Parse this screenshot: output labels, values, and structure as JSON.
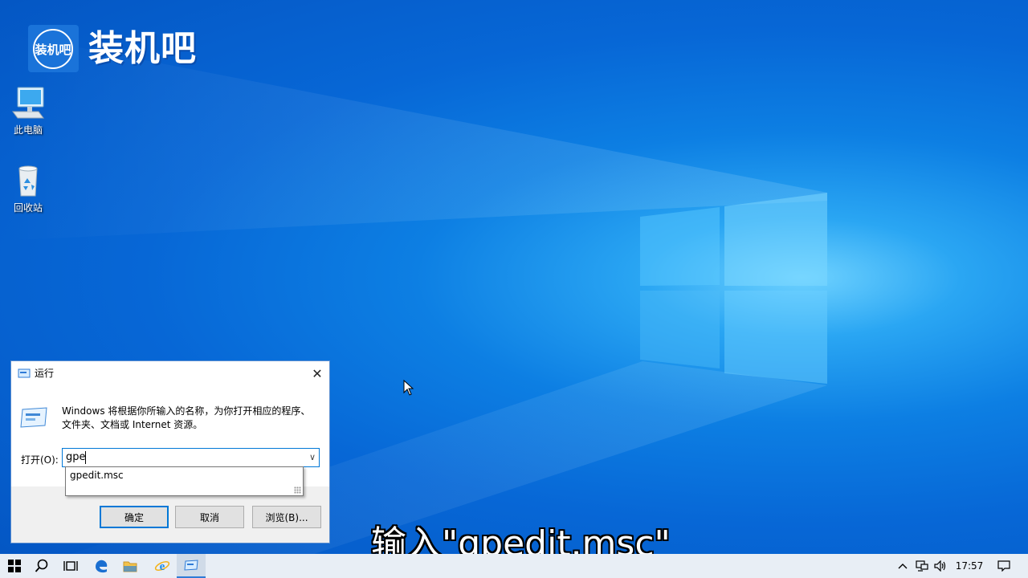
{
  "desktop": {
    "logo": {
      "badge_text": "装机吧",
      "brand_text": "装机吧"
    },
    "icons": [
      {
        "label": "此电脑"
      },
      {
        "label": "回收站"
      }
    ]
  },
  "run_dialog": {
    "title": "运行",
    "close_glyph": "✕",
    "description": "Windows 将根据你所输入的名称，为你打开相应的程序、文件夹、文档或 Internet 资源。",
    "open_label": "打开(O):",
    "input_value": "gpe",
    "suggestions": [
      "gpedit.msc"
    ],
    "buttons": {
      "ok": "确定",
      "cancel": "取消",
      "browse": "浏览(B)..."
    }
  },
  "subtitle": "输入\"gpedit.msc\"",
  "taskbar": {
    "clock": "17:57",
    "pinned": [
      "windows-start-icon",
      "search-icon",
      "task-view-icon",
      "edge-icon",
      "file-explorer-icon",
      "internet-explorer-icon",
      "run-app-icon"
    ],
    "tray": [
      "chevron-up-icon",
      "network-icon",
      "volume-icon",
      "notification-icon"
    ]
  },
  "colors": {
    "accent": "#0078d7",
    "desktop": "#0767d6"
  }
}
